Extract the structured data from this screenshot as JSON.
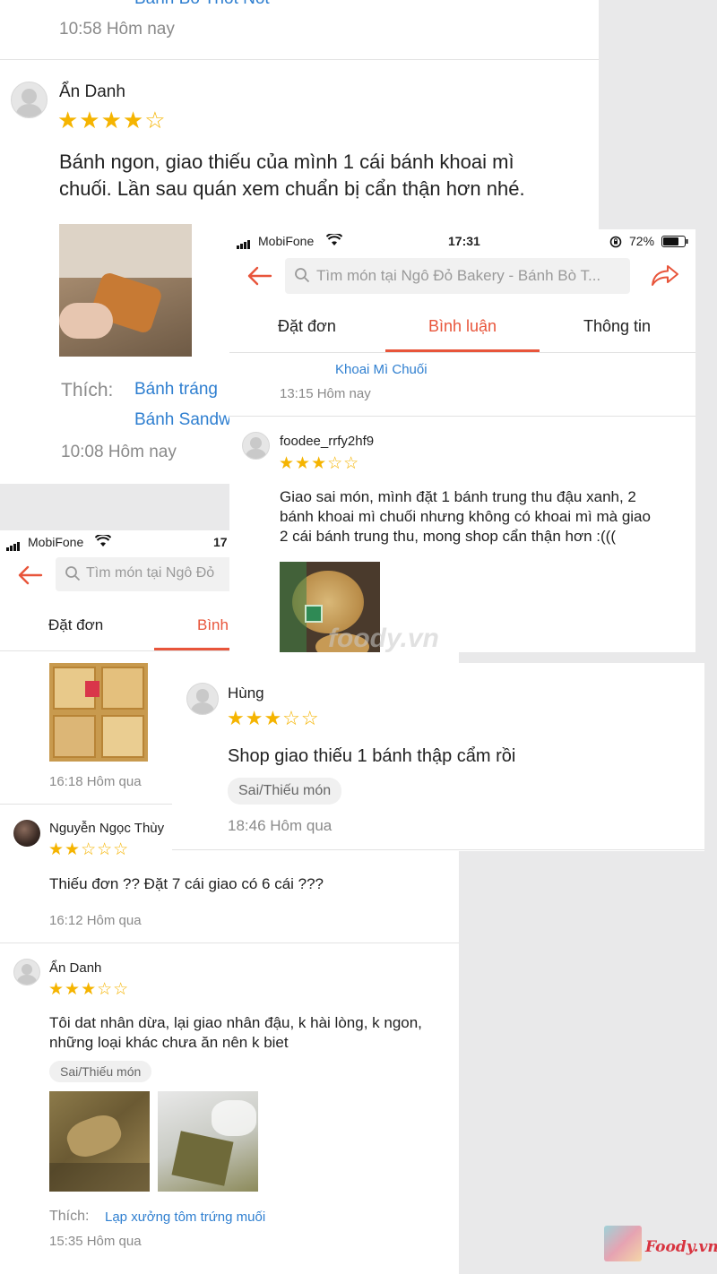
{
  "panelA": {
    "top_link": "Bánh Bò Thốt Nốt",
    "top_time": "10:58 Hôm nay",
    "review": {
      "user": "Ẩn Danh",
      "stars": "★★★★☆",
      "text_line1": "Bánh ngon, giao thiếu của mình 1 cái bánh khoai mì",
      "text_line2": "chuối. Lần sau quán xem chuẩn bị cẩn thận hơn nhé.",
      "like_label": "Thích:",
      "like_item1": "Bánh tráng",
      "like_item2": "Bánh Sandw",
      "time": "10:08 Hôm nay"
    }
  },
  "panelB": {
    "status": {
      "carrier": "MobiFone",
      "time": "17:31",
      "battery": "72%"
    },
    "search_placeholder": "Tìm món tại Ngô Đỏ Bakery - Bánh Bò T...",
    "tabs": [
      "Đặt đơn",
      "Bình luận",
      "Thông tin"
    ],
    "top_link": "Khoai Mì Chuối",
    "top_time": "13:15 Hôm nay",
    "review": {
      "user": "foodee_rrfy2hf9",
      "stars": "★★★☆☆",
      "text_line1": "Giao sai món, mình đặt 1 bánh trung thu đậu xanh, 2",
      "text_line2": "bánh khoai mì chuối nhưng không có khoai mì mà giao",
      "text_line3": "2 cái bánh trung thu, mong shop cẩn thận hơn :((("
    },
    "watermark": "foody.vn"
  },
  "panelC": {
    "user": "Hùng",
    "stars": "★★★☆☆",
    "text": "Shop giao thiếu 1 bánh thập cẩm rồi",
    "tag": "Sai/Thiếu món",
    "time": "18:46 Hôm qua"
  },
  "panelD": {
    "status": {
      "carrier": "MobiFone",
      "time": "17"
    },
    "search_placeholder": "Tìm món tại Ngô Đỏ",
    "tabs": [
      "Đặt đơn",
      "Bình"
    ],
    "top_time": "16:18 Hôm qua",
    "review1": {
      "user": "Nguyễn Ngọc Thùy",
      "stars": "★★☆☆☆",
      "text": "Thiếu đơn ?? Đặt 7 cái giao có 6 cái ???",
      "time": "16:12 Hôm qua"
    },
    "review2": {
      "user": "Ẩn Danh",
      "stars": "★★★☆☆",
      "text_line1": "Tôi dat nhân dừa, lại giao nhân đậu, k hài lòng, k ngon,",
      "text_line2": "những loại khác chưa ăn nên k biet",
      "tag": "Sai/Thiếu món",
      "like_label": "Thích:",
      "like_item": "Lạp xưởng tôm trứng muối",
      "time": "15:35 Hôm qua"
    }
  },
  "logo": {
    "text": "Foody.vn"
  },
  "colors": {
    "accent": "#e8553b",
    "link": "#2f7fd0",
    "star": "#f5b400"
  }
}
